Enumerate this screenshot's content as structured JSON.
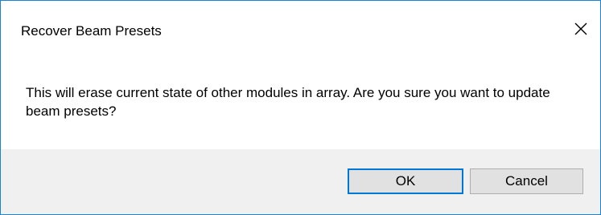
{
  "window": {
    "title": "Recover Beam Presets"
  },
  "message": "This will erase current state of other modules in array. Are you sure you want to update beam presets?",
  "buttons": {
    "ok_label": "OK",
    "cancel_label": "Cancel"
  },
  "icons": {
    "close": "close-icon"
  },
  "colors": {
    "window_border": "#1883d7",
    "default_button_border": "#0078d7",
    "footer_background": "#f0f0f0",
    "button_background": "#e1e1e1"
  }
}
